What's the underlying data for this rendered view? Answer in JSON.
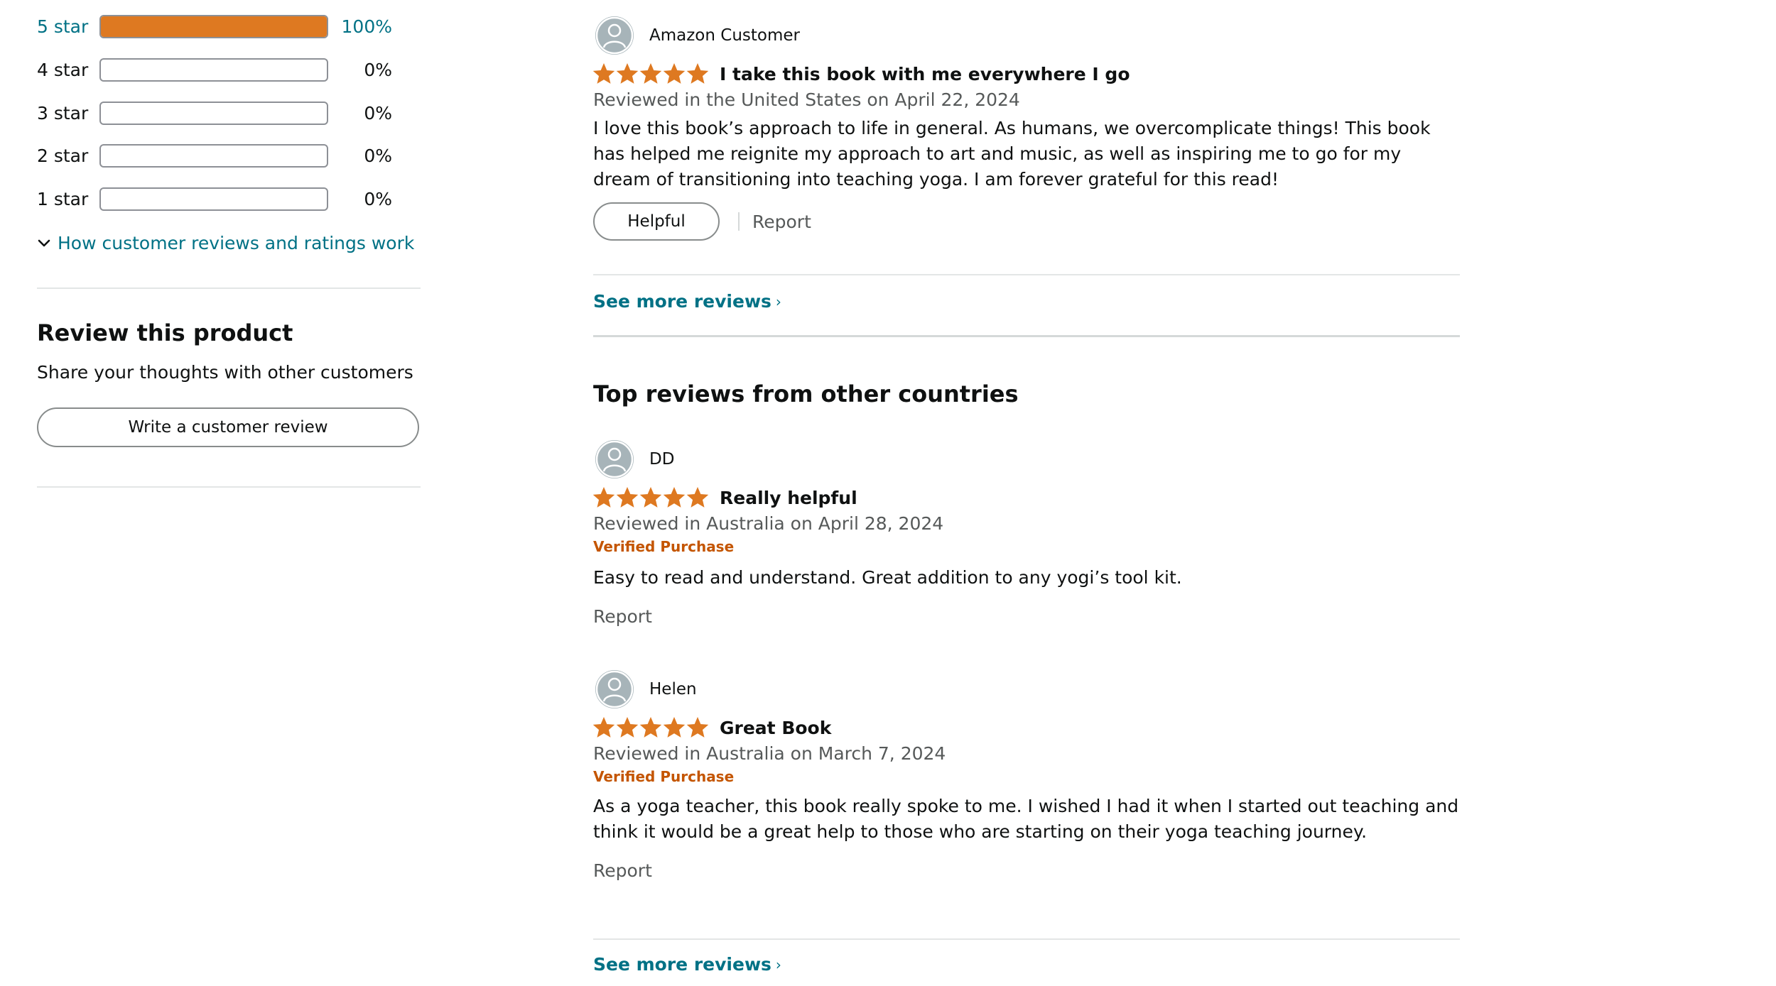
{
  "histogram": [
    {
      "label": "5 star",
      "percent_text": "100%",
      "fill": 1.0,
      "active": true
    },
    {
      "label": "4 star",
      "percent_text": "0%",
      "fill": 0.0,
      "active": false
    },
    {
      "label": "3 star",
      "percent_text": "0%",
      "fill": 0.0,
      "active": false
    },
    {
      "label": "2 star",
      "percent_text": "0%",
      "fill": 0.0,
      "active": false
    },
    {
      "label": "1 star",
      "percent_text": "0%",
      "fill": 0.0,
      "active": false
    }
  ],
  "how_reviews_link": "How customer reviews and ratings work",
  "review_product": {
    "title": "Review this product",
    "subtitle": "Share your thoughts with other customers",
    "button": "Write a customer review"
  },
  "colors": {
    "star": "#de7921",
    "link": "#007185",
    "verified": "#c45500"
  },
  "us_review": {
    "reviewer": "Amazon Customer",
    "rating": 5,
    "title": "I take this book with me everywhere I go",
    "date": "Reviewed in the United States on April 22, 2024",
    "body": "I love this book’s approach to life in general. As humans, we overcomplicate things! This book has helped me reignite my approach to art and music, as well as inspiring me to go for my dream of transitioning into teaching yoga. I am forever grateful for this read!",
    "helpful": "Helpful",
    "report": "Report"
  },
  "see_more_reviews": "See more reviews",
  "other_countries_title": "Top reviews from other countries",
  "other_reviews": [
    {
      "reviewer": "DD",
      "rating": 5,
      "title": "Really helpful",
      "date": "Reviewed in Australia on April 28, 2024",
      "verified": "Verified Purchase",
      "body": "Easy to read and understand. Great addition to any yogi’s tool kit.",
      "report": "Report"
    },
    {
      "reviewer": "Helen",
      "rating": 5,
      "title": "Great Book",
      "date": "Reviewed in Australia on March 7, 2024",
      "verified": "Verified Purchase",
      "body": "As a yoga teacher, this book really spoke to me. I wished I had it when I started out teaching and think it would be a great help to those who are starting on their yoga teaching journey.",
      "report": "Report"
    }
  ]
}
